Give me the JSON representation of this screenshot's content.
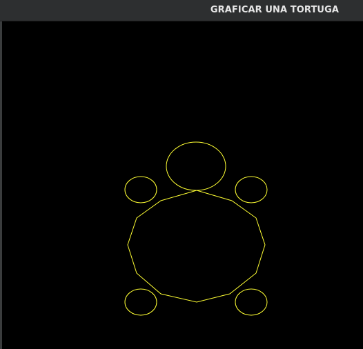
{
  "window": {
    "title": "GRAFICAR UNA TORTUGA"
  },
  "drawing": {
    "subject": "turtle",
    "stroke_color": "#ffff33",
    "background_color": "#000000",
    "parts": [
      "head",
      "front-left-leg",
      "front-right-leg",
      "shell",
      "back-left-leg",
      "back-right-leg"
    ]
  }
}
